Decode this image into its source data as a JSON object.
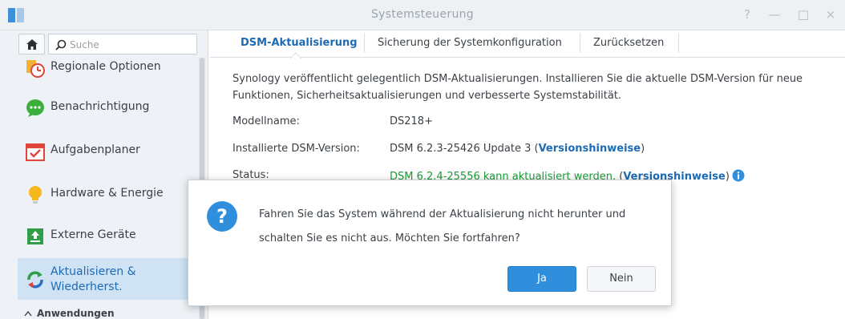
{
  "window": {
    "title": "Systemsteuerung",
    "controls": [
      "?",
      "—",
      "□",
      "×"
    ]
  },
  "sidebar": {
    "search_placeholder": "Suche",
    "items": [
      {
        "label": "Regionale Optionen",
        "icon": "regional-options-icon"
      },
      {
        "label": "Benachrichtigung",
        "icon": "notification-icon"
      },
      {
        "label": "Aufgabenplaner",
        "icon": "task-scheduler-icon"
      },
      {
        "label": "Hardware & Energie",
        "icon": "hardware-power-icon"
      },
      {
        "label": "Externe Geräte",
        "icon": "external-devices-icon"
      },
      {
        "label": "Aktualisieren & Wiederherst.",
        "icon": "update-restore-icon",
        "active": true
      }
    ],
    "section_header": "Anwendungen"
  },
  "tabs": [
    {
      "label": "DSM-Aktualisierung",
      "active": true
    },
    {
      "label": "Sicherung der Systemkonfiguration"
    },
    {
      "label": "Zurücksetzen"
    }
  ],
  "main": {
    "description": "Synology veröffentlicht gelegentlich DSM-Aktualisierungen. Installieren Sie die aktuelle DSM-Version für neue Funktionen, Sicherheitsaktualisierungen und verbesserte Systemstabilität.",
    "model_label": "Modellname:",
    "model_value": "DS218+",
    "installed_label": "Installierte DSM-Version:",
    "installed_value": "DSM 6.2.3-25426 Update 3",
    "installed_link": "Versionshinweise",
    "status_label": "Status:",
    "status_value": "DSM 6.2.4-25556 kann aktualisiert werden.",
    "status_link": "Versionshinweise"
  },
  "dialog": {
    "line1": "Fahren Sie das System während der Aktualisierung nicht herunter und",
    "line2": "schalten Sie es nicht aus. Möchten Sie fortfahren?",
    "yes_label": "Ja",
    "no_label": "Nein"
  },
  "colors": {
    "accent": "#1d6bb5",
    "primary_button": "#2f8fdd",
    "status_green": "#1e9b3a",
    "active_nav_bg": "#cfe3f5"
  }
}
